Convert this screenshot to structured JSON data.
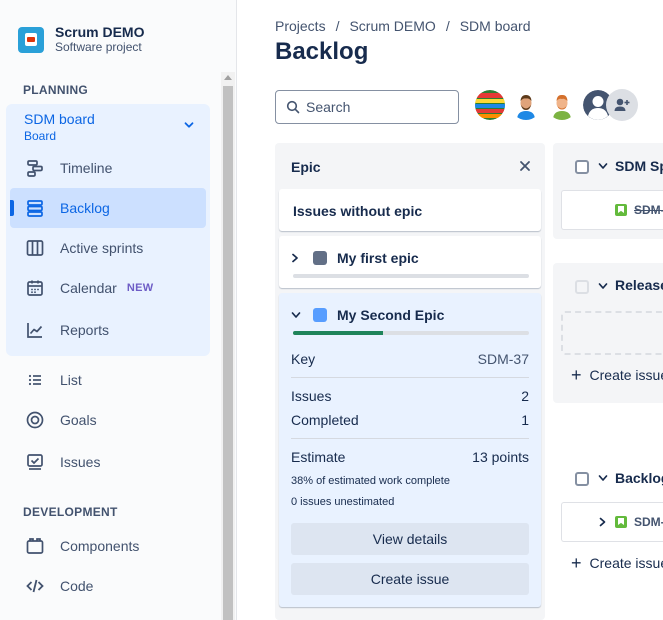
{
  "project": {
    "name": "Scrum DEMO",
    "type": "Software project"
  },
  "sidebar": {
    "planning_label": "PLANNING",
    "board": {
      "name": "SDM board",
      "sub": "Board"
    },
    "items": [
      {
        "label": "Timeline",
        "icon": "timeline-icon"
      },
      {
        "label": "Backlog",
        "icon": "backlog-icon"
      },
      {
        "label": "Active sprints",
        "icon": "columns-icon"
      },
      {
        "label": "Calendar",
        "icon": "calendar-icon",
        "badge": "NEW"
      },
      {
        "label": "Reports",
        "icon": "chart-line-icon"
      }
    ],
    "other_items": [
      {
        "label": "List",
        "icon": "list-icon"
      },
      {
        "label": "Goals",
        "icon": "target-icon"
      },
      {
        "label": "Issues",
        "icon": "issues-icon"
      }
    ],
    "development_label": "DEVELOPMENT",
    "dev_items": [
      {
        "label": "Components",
        "icon": "components-icon"
      },
      {
        "label": "Code",
        "icon": "code-icon"
      }
    ]
  },
  "breadcrumbs": [
    "Projects",
    "SDM board"
  ],
  "breadcrumb_middle": "Scrum DEMO",
  "page_title": "Backlog",
  "search": {
    "placeholder": "Search"
  },
  "epic_panel": {
    "title": "Epic",
    "no_epic": "Issues without epic",
    "epics": [
      {
        "name": "My first epic",
        "color": "#626f86",
        "progress": 0
      },
      {
        "name": "My Second Epic",
        "color": "#579dff",
        "progress": 0.38
      }
    ],
    "details": {
      "key_label": "Key",
      "key_value": "SDM-37",
      "issues_label": "Issues",
      "issues_value": "2",
      "completed_label": "Completed",
      "completed_value": "1",
      "estimate_label": "Estimate",
      "estimate_value": "13 points",
      "estimate_note": "38% of estimated work complete",
      "unestimated_note": "0 issues unestimated"
    },
    "view_details": "View details",
    "create_issue": "Create issue"
  },
  "sprints": [
    {
      "title": "SDM Sp",
      "issue_key": "SDM-"
    },
    {
      "title": "Release",
      "create": "Create issue"
    },
    {
      "title": "Backlog",
      "issue_key": "SDM-",
      "create": "Create issue"
    }
  ],
  "colors": {
    "accent": "#0c66e4",
    "progress": "#1f845a",
    "story": "#63ba3c",
    "new_badge": "#6e5dc6"
  }
}
